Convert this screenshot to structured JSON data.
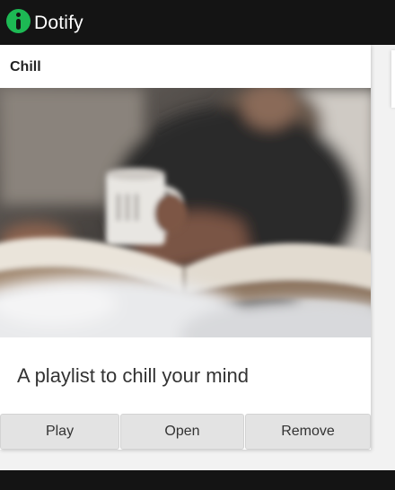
{
  "app": {
    "brand_name": "Dotify",
    "logo_icon": "dotify-logo-icon",
    "accent_color": "#1db954",
    "bar_color": "#141414"
  },
  "card": {
    "title": "Chill",
    "image_icon": "photo-person-reading-book-with-mug",
    "description": "A playlist to chill your mind",
    "actions": {
      "play_label": "Play",
      "open_label": "Open",
      "remove_label": "Remove"
    }
  }
}
